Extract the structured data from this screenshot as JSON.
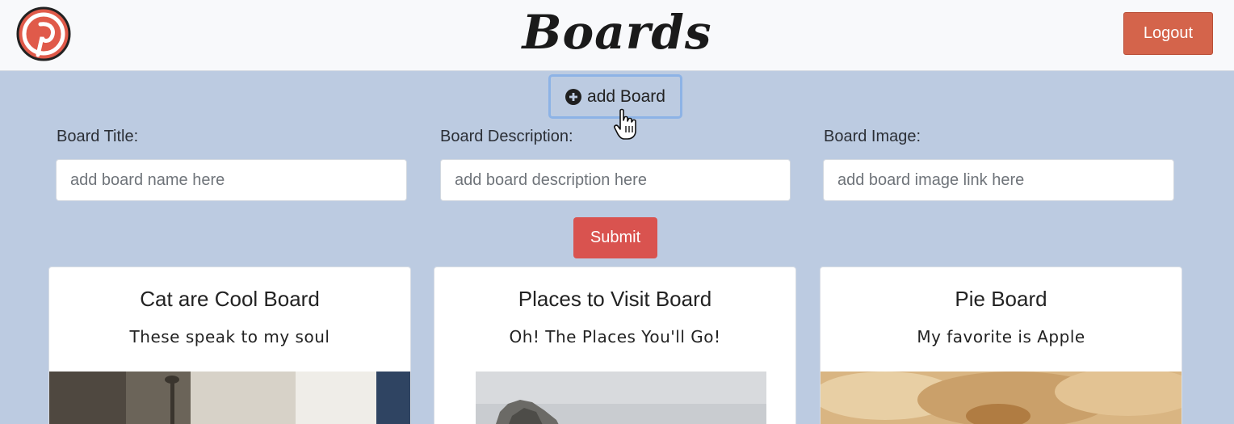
{
  "header": {
    "title": "Boards",
    "logout_label": "Logout",
    "logo_icon": "pinterest-logo-icon",
    "accent_color": "#d4644b"
  },
  "add_board": {
    "label": "add Board",
    "icon": "plus-circle-icon"
  },
  "form": {
    "fields": [
      {
        "label": "Board Title:",
        "placeholder": "add board name here",
        "value": ""
      },
      {
        "label": "Board Description:",
        "placeholder": "add board description here",
        "value": ""
      },
      {
        "label": "Board Image:",
        "placeholder": "add board image link here",
        "value": ""
      }
    ],
    "submit_label": "Submit",
    "submit_color": "#d9534f"
  },
  "boards": [
    {
      "title": "Cat are Cool Board",
      "description": "These speak to my soul"
    },
    {
      "title": "Places to Visit Board",
      "description": "Oh! The Places You'll Go!"
    },
    {
      "title": "Pie Board",
      "description": "My favorite is Apple"
    }
  ],
  "background_color": "#bccbe1"
}
